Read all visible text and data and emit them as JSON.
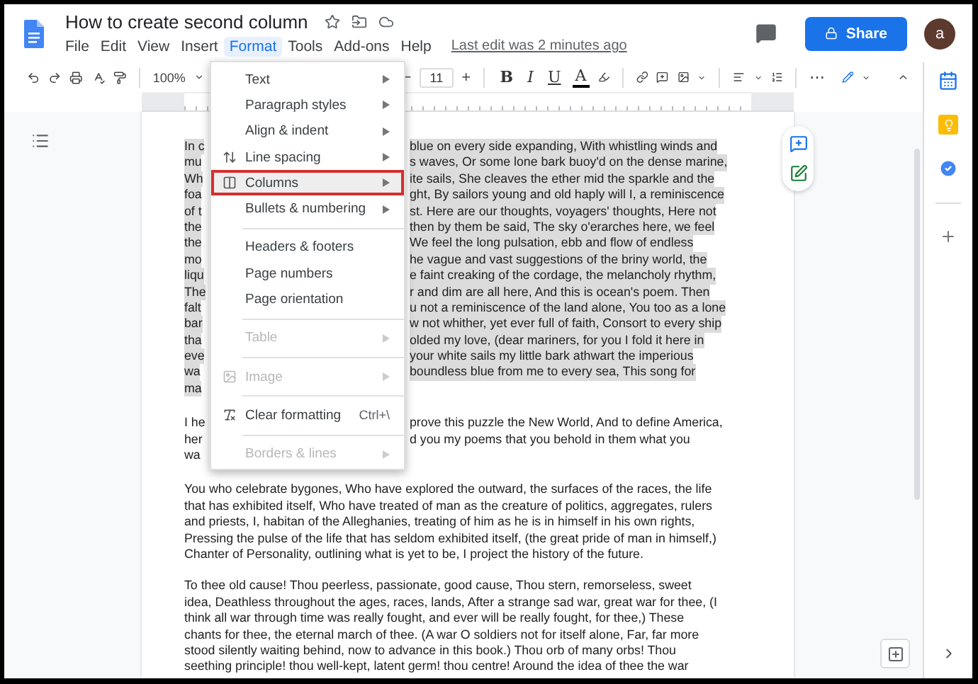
{
  "header": {
    "title": "How to create second column",
    "menus": [
      {
        "label": "File",
        "selected": false
      },
      {
        "label": "Edit",
        "selected": false
      },
      {
        "label": "View",
        "selected": false
      },
      {
        "label": "Insert",
        "selected": false
      },
      {
        "label": "Format",
        "selected": true
      },
      {
        "label": "Tools",
        "selected": false
      },
      {
        "label": "Add-ons",
        "selected": false
      },
      {
        "label": "Help",
        "selected": false
      }
    ],
    "last_edit": "Last edit was 2 minutes ago",
    "share": "Share",
    "avatar": "a"
  },
  "toolbar": {
    "zoom": "100%",
    "decrease": "−",
    "font_size": "11",
    "increase": "+",
    "more": "⋯",
    "format_buttons": [
      {
        "label": "B",
        "kind": "bold"
      },
      {
        "label": "I",
        "kind": "italic"
      },
      {
        "label": "U",
        "kind": "underline"
      },
      {
        "label": "A",
        "kind": "color"
      }
    ]
  },
  "format_menu": {
    "items": [
      {
        "kind": "item",
        "label": "Text",
        "submenu": true,
        "disabled": false,
        "selected": false
      },
      {
        "kind": "item",
        "label": "Paragraph styles",
        "submenu": true,
        "disabled": false,
        "selected": false
      },
      {
        "kind": "item",
        "label": "Align & indent",
        "submenu": true,
        "disabled": false,
        "selected": false
      },
      {
        "kind": "item",
        "label": "Line spacing",
        "submenu": true,
        "disabled": false,
        "selected": false
      },
      {
        "kind": "item",
        "label": "Columns",
        "submenu": true,
        "disabled": false,
        "selected": true
      },
      {
        "kind": "item",
        "label": "Bullets & numbering",
        "submenu": true,
        "disabled": false,
        "selected": false
      },
      {
        "kind": "divider"
      },
      {
        "kind": "item",
        "label": "Headers & footers",
        "submenu": false,
        "disabled": false,
        "selected": false
      },
      {
        "kind": "item",
        "label": "Page numbers",
        "submenu": false,
        "disabled": false,
        "selected": false
      },
      {
        "kind": "item",
        "label": "Page orientation",
        "submenu": false,
        "disabled": false,
        "selected": false
      },
      {
        "kind": "divider"
      },
      {
        "kind": "item",
        "label": "Table",
        "submenu": true,
        "disabled": true,
        "selected": false
      },
      {
        "kind": "divider"
      },
      {
        "kind": "item",
        "label": "Image",
        "submenu": true,
        "disabled": true,
        "selected": false
      },
      {
        "kind": "divider"
      },
      {
        "kind": "item",
        "label": "Clear formatting",
        "submenu": false,
        "disabled": false,
        "selected": false,
        "shortcut": "Ctrl+\\"
      },
      {
        "kind": "divider"
      },
      {
        "kind": "item",
        "label": "Borders & lines",
        "submenu": true,
        "disabled": true,
        "selected": false
      }
    ]
  },
  "document": {
    "paragraphs": [
      {
        "kind": "split",
        "highlighted": true,
        "lines": [
          [
            "In c",
            "blue on every side expanding, With whistling winds and"
          ],
          [
            "mu",
            "s waves, Or some lone bark buoy'd on the dense marine,"
          ],
          [
            "Wh",
            "ite sails, She cleaves the ether mid the sparkle and the"
          ],
          [
            "foa",
            "ght, By sailors young and old haply will I, a reminiscence"
          ],
          [
            "of t",
            "st. Here are our thoughts, voyagers' thoughts, Here not"
          ],
          [
            "the",
            "then by them be said, The sky o'erarches here, we feel"
          ],
          [
            "the",
            "We feel the long pulsation, ebb and flow of endless"
          ],
          [
            "mo",
            "he vague and vast suggestions of the briny world, the"
          ],
          [
            "liqu",
            "e faint creaking of the cordage, the melancholy rhythm,"
          ],
          [
            "The",
            "r and dim are all here, And this is ocean's poem. Then"
          ],
          [
            "falt",
            "u not a reminiscence of the land alone, You too as a lone"
          ],
          [
            "bar",
            "w not whither, yet ever full of faith, Consort to every ship"
          ],
          [
            "tha",
            "olded my love, (dear mariners, for you I fold it here in"
          ],
          [
            "eve",
            "your white sails my little bark athwart the imperious"
          ],
          [
            "wa",
            "boundless blue from me to every sea, This song for"
          ],
          [
            "ma"
          ]
        ]
      },
      {
        "kind": "split",
        "highlighted": false,
        "lines": [
          [
            "I he",
            "prove this puzzle the New World, And to define America,"
          ],
          [
            "her",
            "d you my poems that you behold in them what you"
          ],
          [
            "wa"
          ]
        ]
      },
      {
        "kind": "full",
        "highlighted": false,
        "lines": [
          "You who celebrate bygones, Who have explored the outward, the surfaces of the races, the life",
          "that has exhibited itself, Who have treated of man as the creature of politics, aggregates, rulers",
          "and priests, I, habitan of the Alleghanies, treating of him as he is in himself in his own rights,",
          "Pressing the pulse of the life that has seldom exhibited itself, (the great pride of man in himself,)",
          "Chanter of Personality, outlining what is yet to be, I project the history of the future."
        ]
      },
      {
        "kind": "full",
        "highlighted": false,
        "lines": [
          "To thee old cause! Thou peerless, passionate, good cause, Thou stern, remorseless, sweet",
          "idea, Deathless throughout the ages, races, lands, After a strange sad war, great war for thee, (I",
          "think all war through time was really fought, and ever will be really fought, for thee,) These",
          "chants for thee, the eternal march of thee. (A war O soldiers not for itself alone, Far, far more",
          "stood silently waiting behind, now to advance in this book.) Thou orb of many orbs! Thou",
          "seething principle! thou well-kept, latent germ! thou centre! Around the idea of thee the war"
        ]
      }
    ]
  }
}
